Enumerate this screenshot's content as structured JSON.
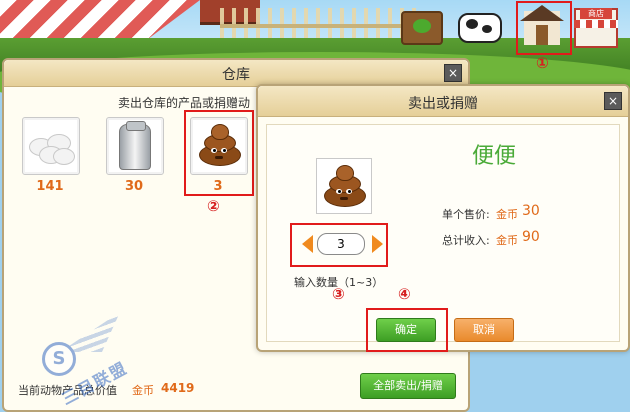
{
  "warehouse": {
    "title": "仓库",
    "subtitle": "卖出仓库的产品或捐赠动",
    "items": [
      {
        "name": "egg",
        "count": "141"
      },
      {
        "name": "milk",
        "count": "30"
      },
      {
        "name": "poop",
        "count": "3"
      }
    ],
    "footer_label": "当前动物产品总价值",
    "footer_gold_label": "金币",
    "footer_value": "4419",
    "sell_all_label": "全部卖出/捐赠",
    "close_glyph": "×"
  },
  "dialog": {
    "title": "卖出或捐赠",
    "item_name": "便便",
    "unit_price_label": "单个售价:",
    "unit_price_gold": "金币",
    "unit_price_value": "30",
    "total_label": "总计收入:",
    "total_gold": "金币",
    "total_value": "90",
    "quantity": "3",
    "quantity_label": "输入数量（1~3）",
    "ok_label": "确定",
    "cancel_label": "取消",
    "close_glyph": "×"
  },
  "annotations": {
    "marker_1": "①",
    "marker_2": "②",
    "marker_3": "③",
    "marker_4": "④"
  },
  "toolbar": {
    "shop_sign": "商店"
  },
  "watermark": {
    "letter": "S",
    "text": "三目联盟"
  },
  "colors": {
    "annotation_red": "#e11b1b",
    "gold_orange": "#e06a1a",
    "name_green": "#4aaa38",
    "button_green": "#3d9e24",
    "button_orange": "#e98a2c"
  }
}
